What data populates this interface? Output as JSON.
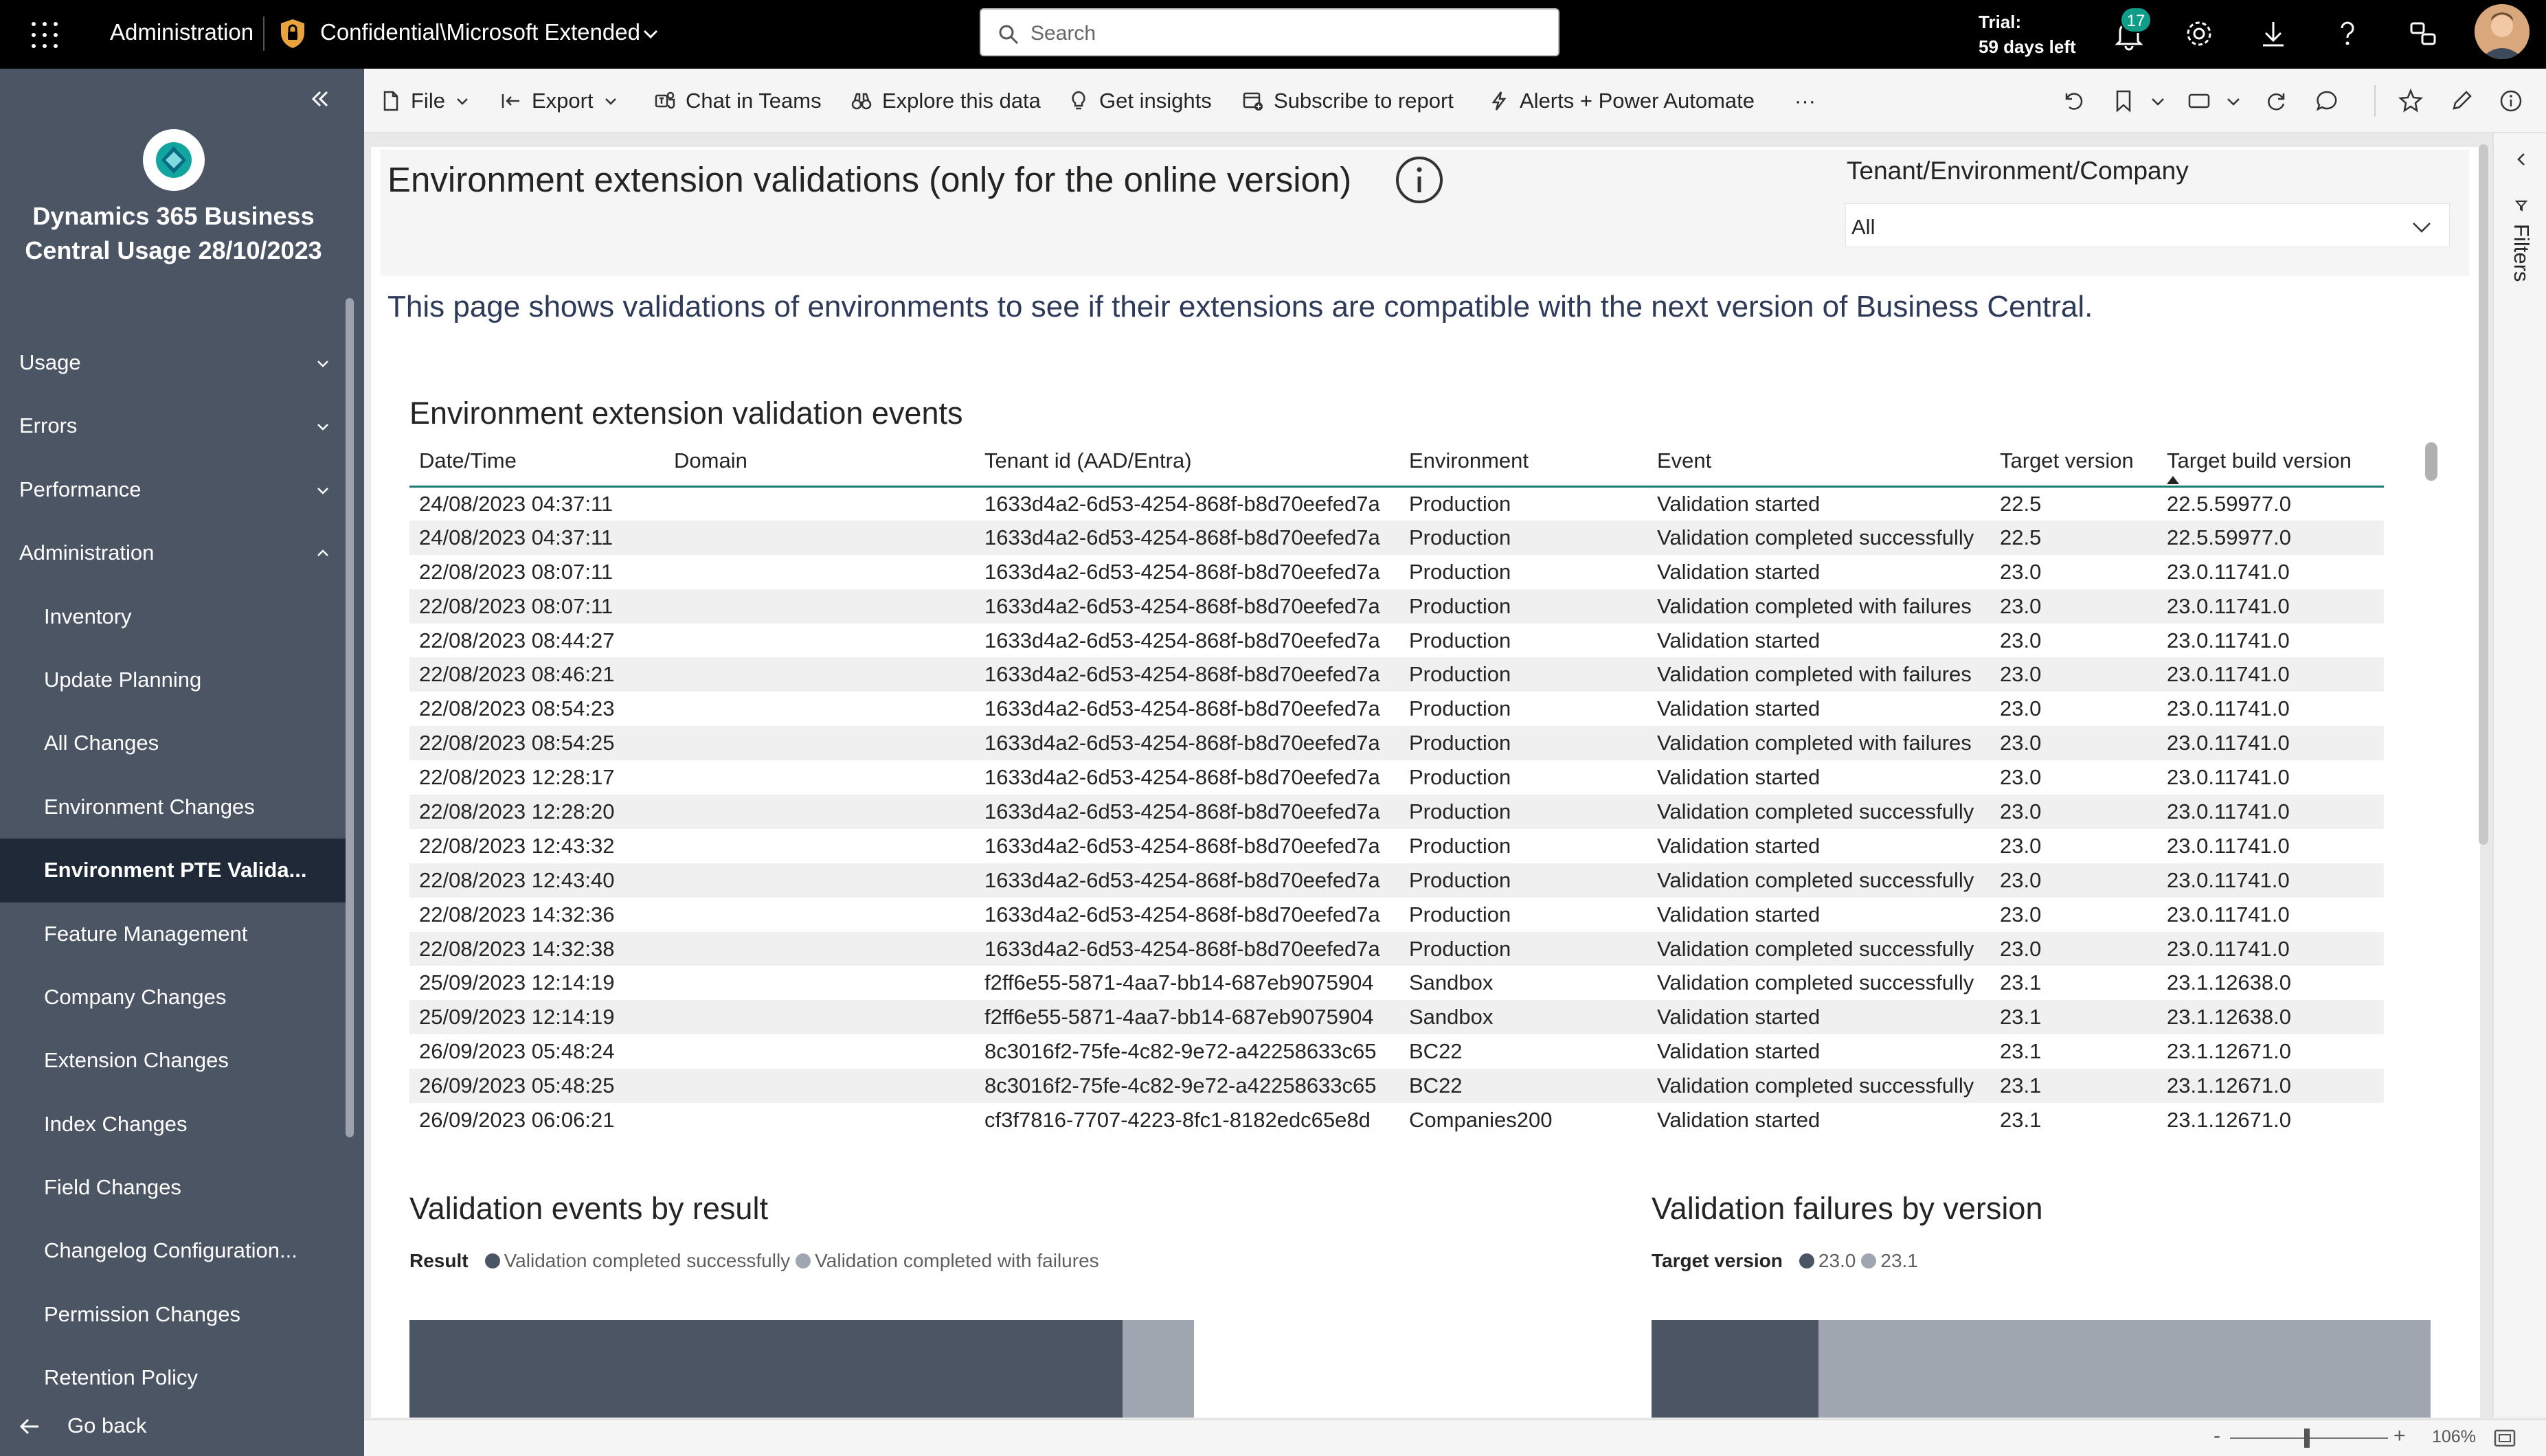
{
  "topbar": {
    "app_name": "Administration",
    "workspace_label": "Confidential\\Microsoft Extended",
    "search_placeholder": "Search",
    "trial_line1": "Trial:",
    "trial_line2": "59 days left",
    "notification_count": "17"
  },
  "sidebar": {
    "report_title_line1": "Dynamics 365 Business",
    "report_title_line2": "Central Usage 28/10/2023",
    "items": [
      {
        "label": "Usage",
        "level": "top",
        "chevron": "down"
      },
      {
        "label": "Errors",
        "level": "top",
        "chevron": "down"
      },
      {
        "label": "Performance",
        "level": "top",
        "chevron": "down"
      },
      {
        "label": "Administration",
        "level": "top",
        "chevron": "up"
      },
      {
        "label": "Inventory",
        "level": "sub"
      },
      {
        "label": "Update Planning",
        "level": "sub"
      },
      {
        "label": "All Changes",
        "level": "sub"
      },
      {
        "label": "Environment Changes",
        "level": "sub"
      },
      {
        "label": "Environment PTE Valida...",
        "level": "sub",
        "active": true
      },
      {
        "label": "Feature Management",
        "level": "sub"
      },
      {
        "label": "Company Changes",
        "level": "sub"
      },
      {
        "label": "Extension Changes",
        "level": "sub"
      },
      {
        "label": "Index Changes",
        "level": "sub"
      },
      {
        "label": "Field Changes",
        "level": "sub"
      },
      {
        "label": "Changelog Configuration...",
        "level": "sub"
      },
      {
        "label": "Permission Changes",
        "level": "sub"
      },
      {
        "label": "Retention Policy",
        "level": "sub"
      }
    ],
    "go_back": "Go back"
  },
  "toolbar": {
    "file": "File",
    "export": "Export",
    "chat_in_teams": "Chat in Teams",
    "explore": "Explore this data",
    "insights": "Get insights",
    "subscribe": "Subscribe to report",
    "alerts": "Alerts + Power Automate",
    "more": "···"
  },
  "filters_pane_label": "Filters",
  "page": {
    "title": "Environment extension validations (only for the online version)",
    "slicer_label": "Tenant/Environment/Company",
    "slicer_value": "All",
    "description": "This page shows validations of environments to see if their extensions are compatible with the next version of Business Central."
  },
  "table": {
    "title": "Environment extension validation events",
    "columns": [
      "Date/Time",
      "Domain",
      "Tenant id (AAD/Entra)",
      "Environment",
      "Event",
      "Target version",
      "Target build version"
    ],
    "rows": [
      [
        "24/08/2023 04:37:11",
        "",
        "1633d4a2-6d53-4254-868f-b8d70eefed7a",
        "Production",
        "Validation started",
        "22.5",
        "22.5.59977.0"
      ],
      [
        "24/08/2023 04:37:11",
        "",
        "1633d4a2-6d53-4254-868f-b8d70eefed7a",
        "Production",
        "Validation completed successfully",
        "22.5",
        "22.5.59977.0"
      ],
      [
        "22/08/2023 08:07:11",
        "",
        "1633d4a2-6d53-4254-868f-b8d70eefed7a",
        "Production",
        "Validation started",
        "23.0",
        "23.0.11741.0"
      ],
      [
        "22/08/2023 08:07:11",
        "",
        "1633d4a2-6d53-4254-868f-b8d70eefed7a",
        "Production",
        "Validation completed with failures",
        "23.0",
        "23.0.11741.0"
      ],
      [
        "22/08/2023 08:44:27",
        "",
        "1633d4a2-6d53-4254-868f-b8d70eefed7a",
        "Production",
        "Validation started",
        "23.0",
        "23.0.11741.0"
      ],
      [
        "22/08/2023 08:46:21",
        "",
        "1633d4a2-6d53-4254-868f-b8d70eefed7a",
        "Production",
        "Validation completed with failures",
        "23.0",
        "23.0.11741.0"
      ],
      [
        "22/08/2023 08:54:23",
        "",
        "1633d4a2-6d53-4254-868f-b8d70eefed7a",
        "Production",
        "Validation started",
        "23.0",
        "23.0.11741.0"
      ],
      [
        "22/08/2023 08:54:25",
        "",
        "1633d4a2-6d53-4254-868f-b8d70eefed7a",
        "Production",
        "Validation completed with failures",
        "23.0",
        "23.0.11741.0"
      ],
      [
        "22/08/2023 12:28:17",
        "",
        "1633d4a2-6d53-4254-868f-b8d70eefed7a",
        "Production",
        "Validation started",
        "23.0",
        "23.0.11741.0"
      ],
      [
        "22/08/2023 12:28:20",
        "",
        "1633d4a2-6d53-4254-868f-b8d70eefed7a",
        "Production",
        "Validation completed successfully",
        "23.0",
        "23.0.11741.0"
      ],
      [
        "22/08/2023 12:43:32",
        "",
        "1633d4a2-6d53-4254-868f-b8d70eefed7a",
        "Production",
        "Validation started",
        "23.0",
        "23.0.11741.0"
      ],
      [
        "22/08/2023 12:43:40",
        "",
        "1633d4a2-6d53-4254-868f-b8d70eefed7a",
        "Production",
        "Validation completed successfully",
        "23.0",
        "23.0.11741.0"
      ],
      [
        "22/08/2023 14:32:36",
        "",
        "1633d4a2-6d53-4254-868f-b8d70eefed7a",
        "Production",
        "Validation started",
        "23.0",
        "23.0.11741.0"
      ],
      [
        "22/08/2023 14:32:38",
        "",
        "1633d4a2-6d53-4254-868f-b8d70eefed7a",
        "Production",
        "Validation completed successfully",
        "23.0",
        "23.0.11741.0"
      ],
      [
        "25/09/2023 12:14:19",
        "",
        "f2ff6e55-5871-4aa7-bb14-687eb9075904",
        "Sandbox",
        "Validation completed successfully",
        "23.1",
        "23.1.12638.0"
      ],
      [
        "25/09/2023 12:14:19",
        "",
        "f2ff6e55-5871-4aa7-bb14-687eb9075904",
        "Sandbox",
        "Validation started",
        "23.1",
        "23.1.12638.0"
      ],
      [
        "26/09/2023 05:48:24",
        "",
        "8c3016f2-75fe-4c82-9e72-a42258633c65",
        "BC22",
        "Validation started",
        "23.1",
        "23.1.12671.0"
      ],
      [
        "26/09/2023 05:48:25",
        "",
        "8c3016f2-75fe-4c82-9e72-a42258633c65",
        "BC22",
        "Validation completed successfully",
        "23.1",
        "23.1.12671.0"
      ],
      [
        "26/09/2023 06:06:21",
        "",
        "cf3f7816-7707-4223-8fc1-8182edc65e8d",
        "Companies200",
        "Validation started",
        "23.1",
        "23.1.12671.0"
      ]
    ]
  },
  "charts": {
    "left": {
      "title": "Validation events by result",
      "legend_title": "Result",
      "legend": [
        "Validation completed successfully",
        "Validation completed with failures"
      ]
    },
    "right": {
      "title": "Validation failures by version",
      "legend_title": "Target version",
      "legend": [
        "23.0",
        "23.1"
      ]
    }
  },
  "chart_data": [
    {
      "type": "bar",
      "orientation": "horizontal-stacked",
      "title": "Validation events by result",
      "series": [
        {
          "name": "Validation completed successfully",
          "values": [
            10
          ],
          "color": "#4b5563"
        },
        {
          "name": "Validation completed with failures",
          "values": [
            1
          ],
          "color": "#a0a6b0"
        }
      ]
    },
    {
      "type": "bar",
      "orientation": "horizontal-stacked",
      "title": "Validation failures by version",
      "series": [
        {
          "name": "23.0",
          "values": [
            3
          ],
          "color": "#4b5563"
        },
        {
          "name": "23.1",
          "values": [
            11
          ],
          "color": "#a0a6b0"
        }
      ]
    }
  ],
  "status": {
    "zoom": "106%"
  },
  "colors": {
    "sidebar": "#4b5563",
    "active": "#1f2937",
    "accent": "#1b7e6e",
    "series_dark": "#4b5563",
    "series_light": "#a0a6b0"
  }
}
